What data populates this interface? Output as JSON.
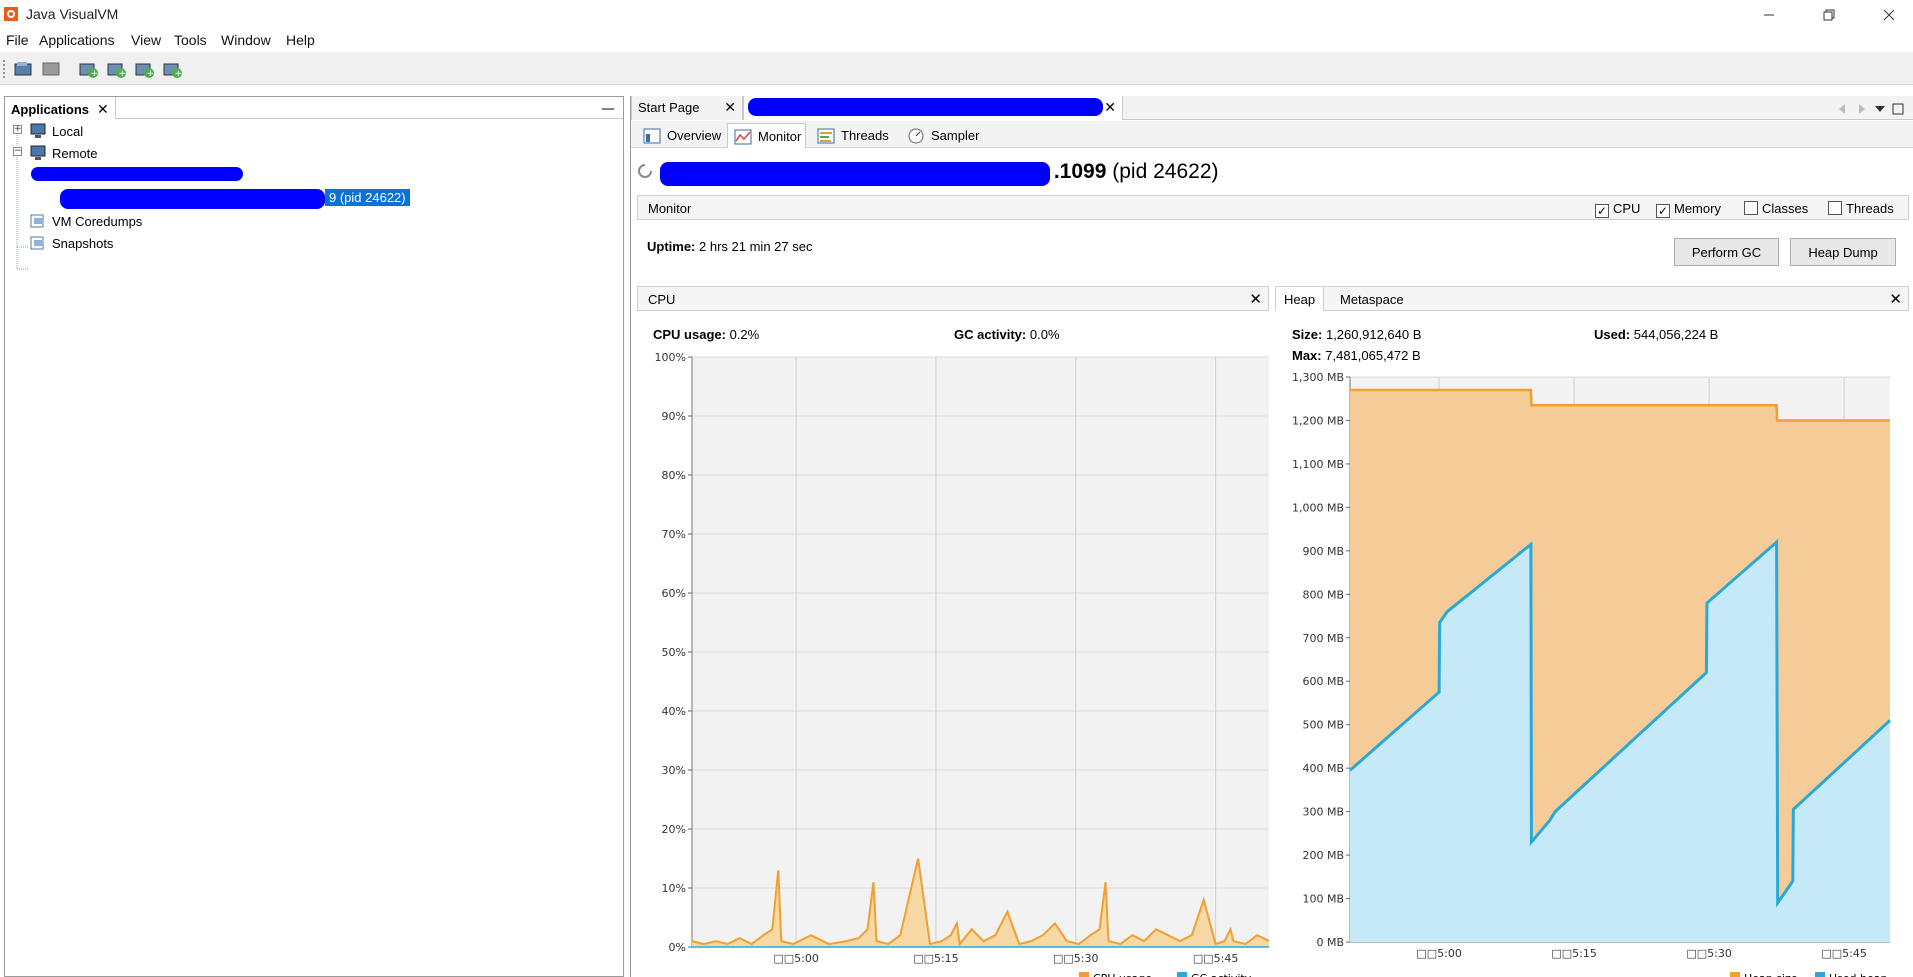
{
  "window": {
    "title": "Java VisualVM"
  },
  "menu": [
    "File",
    "Applications",
    "View",
    "Tools",
    "Window",
    "Help"
  ],
  "left_panel": {
    "tab": "Applications",
    "nodes": {
      "local": "Local",
      "remote": "Remote",
      "selected": "9 (pid 24622)",
      "coredumps": "VM Coredumps",
      "snapshots": "Snapshots"
    }
  },
  "doc_tabs": {
    "start": "Start Page"
  },
  "sub_tabs": [
    "Overview",
    "Monitor",
    "Threads",
    "Sampler"
  ],
  "process": {
    "title_suffix": ".1099",
    "pid": "(pid 24622)"
  },
  "monitor": {
    "label": "Monitor",
    "checkboxes": [
      {
        "label": "CPU",
        "checked": true
      },
      {
        "label": "Memory",
        "checked": true
      },
      {
        "label": "Classes",
        "checked": false
      },
      {
        "label": "Threads",
        "checked": false
      }
    ],
    "uptime_label": "Uptime:",
    "uptime_value": "2 hrs 21 min 27 sec",
    "perform_gc": "Perform GC",
    "heap_dump": "Heap Dump"
  },
  "cpu_panel": {
    "title": "CPU",
    "usage_label": "CPU usage:",
    "usage_value": "0.2%",
    "gc_label": "GC activity:",
    "gc_value": "0.0%",
    "legend": [
      "CPU usage",
      "GC activity"
    ]
  },
  "heap_panel": {
    "tabs": [
      "Heap",
      "Metaspace"
    ],
    "size_label": "Size:",
    "size_value": "1,260,912,640 B",
    "used_label": "Used:",
    "used_value": "544,056,224 B",
    "max_label": "Max:",
    "max_value": "7,481,065,472 B",
    "legend": [
      "Heap size",
      "Used heap"
    ]
  },
  "colors": {
    "selection": "#0a72d4",
    "cpu": "#f0a030",
    "gc": "#2aa8d8",
    "heap_line": "#f0a030",
    "used_line": "#2aa8d8"
  },
  "chart_data": [
    {
      "type": "line",
      "title": "",
      "ylabel": "",
      "x_ticks": [
        "□□5:00",
        "□□5:15",
        "□□5:30",
        "□□5:45"
      ],
      "y_ticks": [
        "0%",
        "10%",
        "20%",
        "30%",
        "40%",
        "50%",
        "60%",
        "70%",
        "80%",
        "90%",
        "100%"
      ],
      "ylim": [
        0,
        100
      ],
      "xlim": [
        0,
        100
      ],
      "series": [
        {
          "name": "CPU usage",
          "x": [
            0,
            2,
            4,
            6,
            8,
            10,
            12,
            13.5,
            14.5,
            15,
            17,
            20,
            23,
            26,
            28,
            29.5,
            30.5,
            31,
            33,
            35,
            38,
            40,
            42,
            43.5,
            44.5,
            45,
            47,
            49,
            51,
            53,
            55,
            57,
            59,
            61,
            63,
            65,
            67,
            68.5,
            69.5,
            70,
            72,
            74,
            76,
            78,
            80,
            82,
            84,
            86,
            88,
            89.5,
            90.5,
            91,
            93,
            95,
            97,
            100
          ],
          "y": [
            1,
            0.5,
            1,
            0.5,
            1.5,
            0.5,
            2,
            3,
            13,
            1,
            0.5,
            2,
            0.5,
            1,
            1.5,
            3,
            11,
            1,
            0.5,
            2,
            15,
            0.5,
            1,
            2,
            4,
            0.5,
            3,
            1,
            2,
            6,
            0.5,
            1,
            2,
            4,
            1,
            0.5,
            2,
            3,
            11,
            1,
            0.5,
            2,
            1,
            3,
            2,
            1,
            2,
            8,
            0.5,
            1,
            3,
            1,
            0.5,
            2,
            1,
            0.5
          ]
        },
        {
          "name": "GC activity",
          "x": [
            0,
            100
          ],
          "y": [
            0,
            0
          ]
        }
      ]
    },
    {
      "type": "area",
      "title": "",
      "ylabel": "",
      "x_ticks": [
        "□□5:00",
        "□□5:15",
        "□□5:30",
        "□□5:45"
      ],
      "y_ticks": [
        "0 MB",
        "100 MB",
        "200 MB",
        "300 MB",
        "400 MB",
        "500 MB",
        "600 MB",
        "700 MB",
        "800 MB",
        "900 MB",
        "1,000 MB",
        "1,100 MB",
        "1,200 MB",
        "1,300 MB"
      ],
      "ylim": [
        0,
        1300
      ],
      "xlim": [
        0,
        100
      ],
      "series": [
        {
          "name": "Heap size",
          "x": [
            0,
            33.5,
            33.6,
            79,
            79.1,
            100
          ],
          "y": [
            1270,
            1270,
            1235,
            1235,
            1200,
            1200
          ]
        },
        {
          "name": "Used heap",
          "x": [
            0,
            16.5,
            16.6,
            18,
            33.5,
            33.6,
            37,
            38,
            66,
            66.1,
            79,
            79.2,
            82,
            82.1,
            100
          ],
          "y": [
            395,
            575,
            735,
            760,
            915,
            230,
            280,
            300,
            620,
            780,
            920,
            90,
            140,
            305,
            510
          ]
        }
      ]
    }
  ]
}
